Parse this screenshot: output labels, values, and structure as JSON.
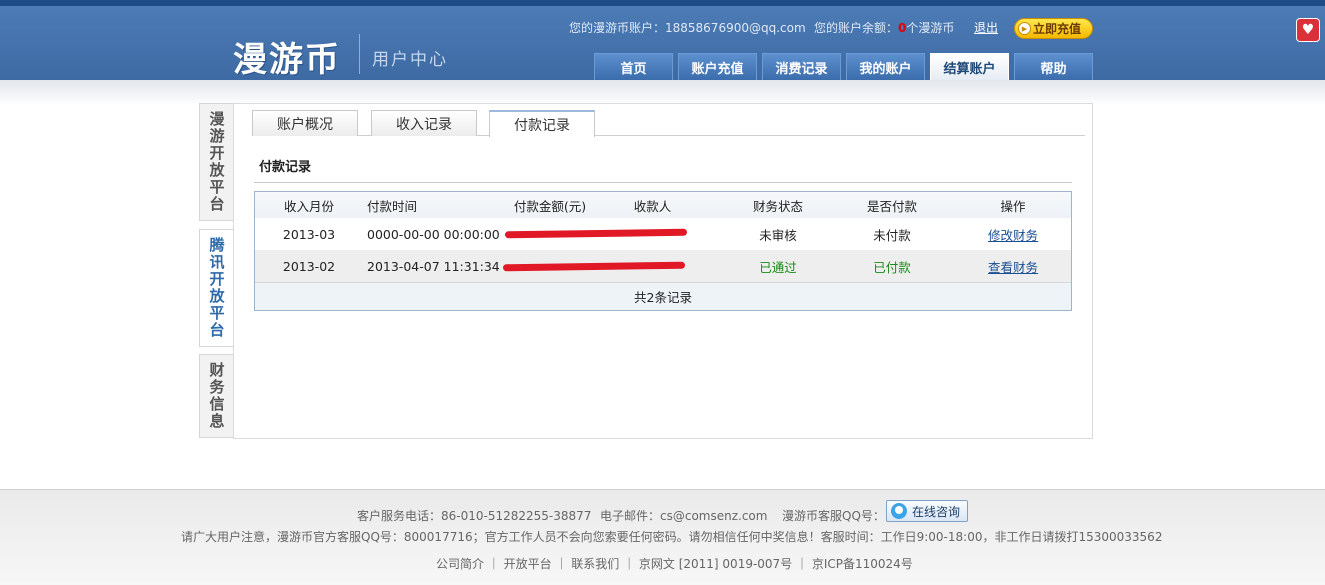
{
  "header": {
    "logo": "漫游币",
    "subtitle": "用户中心",
    "account_label": "您的漫游币账户：18858676900@qq.com",
    "balance_prefix": "您的账户余额：",
    "balance_value": "0",
    "balance_suffix": "个漫游币",
    "logout": "退出",
    "recharge": "立即充值"
  },
  "nav": {
    "items": [
      "首页",
      "账户充值",
      "消费记录",
      "我的账户",
      "结算账户",
      "帮助"
    ],
    "active": "结算账户"
  },
  "sidebar": {
    "tabs": [
      "漫游开放平台",
      "腾讯开放平台",
      "财务信息"
    ],
    "active": "腾讯开放平台"
  },
  "tabs": {
    "items": [
      "账户概况",
      "收入记录",
      "付款记录"
    ],
    "active": "付款记录"
  },
  "section_title": "付款记录",
  "table": {
    "headers": [
      "收入月份",
      "付款时间",
      "付款金额(元)",
      "收款人",
      "财务状态",
      "是否付款",
      "操作"
    ],
    "rows": [
      {
        "month": "2013-03",
        "time": "0000-00-00 00:00:00",
        "status": "未审核",
        "paid": "未付款",
        "action": "修改财务"
      },
      {
        "month": "2013-02",
        "time": "2013-04-07 11:31:34",
        "status": "已通过",
        "paid": "已付款",
        "action": "查看财务"
      }
    ],
    "footer": "共2条记录"
  },
  "colors": {
    "header_bg": "#3e6aa3",
    "status_green": "#1a8a17",
    "link_blue": "#1a4f95",
    "redaction": "#e11826"
  },
  "footer": {
    "line1_phone": "客户服务电话：86-010-51282255-38877",
    "line1_email": "电子邮件：cs@comsenz.com",
    "line1_qq": "漫游币客服QQ号：",
    "consult": "在线咨询",
    "line2": "请广大用户注意，漫游币官方客服QQ号：800017716；官方工作人员不会向您索要任何密码。请勿相信任何中奖信息！客服时间：工作日9:00-18:00，非工作日请拨打15300033562",
    "line3": "公司简介 ｜ 开放平台 ｜ 联系我们 ｜ 京网文 [2011] 0019-007号 ｜ 京ICP备110024号"
  }
}
